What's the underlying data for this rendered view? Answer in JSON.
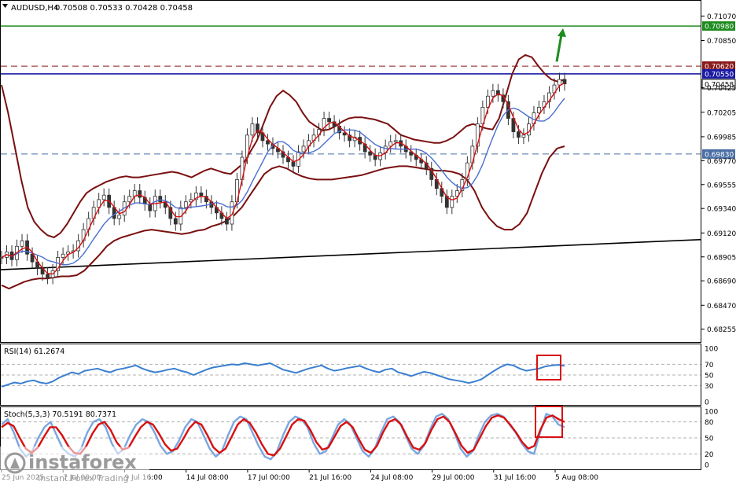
{
  "chart_data": {
    "type": "line",
    "symbol": "AUDUSD,H4",
    "ohlc": "0.70508 0.70533 0.70428 0.70458",
    "price_axis": {
      "ylim": [
        0.6814,
        0.712
      ],
      "ticks": [
        "0.71070",
        "0.70850",
        "0.70425",
        "0.70205",
        "0.69985",
        "0.69770",
        "0.69555",
        "0.69340",
        "0.69120",
        "0.68905",
        "0.68690",
        "0.68470",
        "0.68255"
      ],
      "tick_values": [
        0.7107,
        0.7085,
        0.70425,
        0.70205,
        0.69985,
        0.6977,
        0.69555,
        0.6934,
        0.6912,
        0.68905,
        0.6869,
        0.6847,
        0.68255
      ]
    },
    "levels": [
      {
        "value": 0.7098,
        "label": "0.70980",
        "color": "#1e8c1e",
        "style": "solid"
      },
      {
        "value": 0.7062,
        "label": "0.70620",
        "color": "#8b1a1a",
        "style": "dashed"
      },
      {
        "value": 0.7055,
        "label": "0.70550",
        "color": "#1a1aa6",
        "style": "solid"
      },
      {
        "value": 0.70458,
        "label": "0.70458",
        "color": "#111111",
        "style": "current"
      },
      {
        "value": 0.6983,
        "label": "0.69830",
        "color": "#4a6fa5",
        "style": "dashed"
      }
    ],
    "x_labels": [
      "25 Jun 2025",
      "7 Jul 00:00",
      "9 Jul 16:00",
      "14 Jul 08:00",
      "17 Jul 00:00",
      "21 Jul 16:00",
      "24 Jul 08:00",
      "29 Jul 00:00",
      "31 Jul 16:00",
      "5 Aug 08:00"
    ],
    "trendline": {
      "from": [
        0,
        0.6879
      ],
      "to": [
        134,
        0.6906
      ]
    },
    "series": [
      {
        "name": "price",
        "color": "#3a3a3a",
        "values": [
          0.689,
          0.6895,
          0.6888,
          0.69,
          0.6905,
          0.6893,
          0.6886,
          0.688,
          0.6875,
          0.6872,
          0.6878,
          0.689,
          0.6893,
          0.6895,
          0.6896,
          0.6905,
          0.6915,
          0.6925,
          0.6935,
          0.6942,
          0.6946,
          0.6935,
          0.6925,
          0.6928,
          0.694,
          0.6945,
          0.695,
          0.6944,
          0.6938,
          0.6932,
          0.6945,
          0.694,
          0.6935,
          0.6925,
          0.692,
          0.6935,
          0.694,
          0.6942,
          0.6948,
          0.6945,
          0.694,
          0.6935,
          0.693,
          0.6925,
          0.692,
          0.694,
          0.696,
          0.698,
          0.7,
          0.701,
          0.7002,
          0.6995,
          0.6992,
          0.6988,
          0.6985,
          0.698,
          0.6976,
          0.6972,
          0.6985,
          0.699,
          0.6995,
          0.7,
          0.7005,
          0.7015,
          0.7012,
          0.7008,
          0.7002,
          0.7,
          0.6995,
          0.6998,
          0.6992,
          0.6985,
          0.6982,
          0.6978,
          0.6984,
          0.699,
          0.6994,
          0.6995,
          0.699,
          0.6985,
          0.6982,
          0.6978,
          0.6975,
          0.697,
          0.696,
          0.6952,
          0.6945,
          0.6935,
          0.6945,
          0.695,
          0.696,
          0.6975,
          0.699,
          0.701,
          0.7025,
          0.7035,
          0.704,
          0.7036,
          0.703,
          0.7015,
          0.7003,
          0.6998,
          0.7,
          0.701,
          0.702,
          0.7025,
          0.703,
          0.7038,
          0.7045,
          0.705,
          0.7046
        ]
      },
      {
        "name": "bb_upper",
        "color": "#7a1010",
        "values": [
          0.7045,
          0.702,
          0.699,
          0.696,
          0.6935,
          0.6922,
          0.6915,
          0.691,
          0.6908,
          0.6912,
          0.692,
          0.693,
          0.694,
          0.6948,
          0.6952,
          0.6955,
          0.6958,
          0.696,
          0.6962,
          0.6963,
          0.6962,
          0.6962,
          0.6963,
          0.6964,
          0.6965,
          0.6966,
          0.6967,
          0.6966,
          0.6964,
          0.6962,
          0.6965,
          0.6968,
          0.697,
          0.6968,
          0.6966,
          0.6965,
          0.697,
          0.6975,
          0.6985,
          0.6995,
          0.701,
          0.7025,
          0.7035,
          0.704,
          0.7036,
          0.703,
          0.702,
          0.7012,
          0.7008,
          0.7004,
          0.7005,
          0.7008,
          0.7012,
          0.7015,
          0.7016,
          0.7016,
          0.7015,
          0.7014,
          0.7012,
          0.701,
          0.7005,
          0.7,
          0.6998,
          0.6996,
          0.6995,
          0.6994,
          0.6993,
          0.6993,
          0.6995,
          0.6998,
          0.7003,
          0.7008,
          0.701,
          0.7008,
          0.7006,
          0.7005,
          0.7015,
          0.7035,
          0.7055,
          0.7068,
          0.7072,
          0.707,
          0.7062,
          0.7055,
          0.705,
          0.7048,
          0.705
        ]
      },
      {
        "name": "bb_lower",
        "color": "#7a1010",
        "values": [
          0.6865,
          0.6862,
          0.6865,
          0.6868,
          0.687,
          0.6871,
          0.6871,
          0.6872,
          0.6873,
          0.6873,
          0.6874,
          0.6878,
          0.6885,
          0.6892,
          0.69,
          0.6905,
          0.6908,
          0.691,
          0.6912,
          0.6914,
          0.6915,
          0.6914,
          0.6913,
          0.6912,
          0.6911,
          0.6912,
          0.6914,
          0.6915,
          0.6918,
          0.692,
          0.6923,
          0.6928,
          0.6935,
          0.6945,
          0.6955,
          0.6965,
          0.697,
          0.6972,
          0.697,
          0.6966,
          0.6963,
          0.6961,
          0.696,
          0.696,
          0.696,
          0.6961,
          0.6962,
          0.6963,
          0.6964,
          0.6966,
          0.6968,
          0.697,
          0.6971,
          0.6972,
          0.6972,
          0.6971,
          0.697,
          0.6969,
          0.6968,
          0.6968,
          0.6967,
          0.6965,
          0.696,
          0.695,
          0.6935,
          0.6925,
          0.6918,
          0.6915,
          0.6915,
          0.692,
          0.693,
          0.6948,
          0.6966,
          0.698,
          0.6988,
          0.699
        ]
      }
    ],
    "rsi": {
      "label": "RSI(14) 61.2674",
      "ylim": [
        0,
        100
      ],
      "ticks": [
        "100",
        "70",
        "50",
        "30",
        "0"
      ],
      "tick_values": [
        100,
        70,
        50,
        30,
        0
      ],
      "color": "#3a7fd0",
      "values": [
        28,
        32,
        36,
        34,
        38,
        40,
        36,
        34,
        38,
        45,
        50,
        55,
        52,
        58,
        60,
        62,
        58,
        55,
        60,
        62,
        65,
        68,
        62,
        58,
        55,
        57,
        60,
        62,
        58,
        55,
        50,
        55,
        60,
        64,
        66,
        68,
        70,
        69,
        72,
        70,
        68,
        70,
        72,
        66,
        60,
        57,
        54,
        58,
        62,
        65,
        68,
        62,
        58,
        60,
        63,
        65,
        67,
        62,
        58,
        55,
        60,
        62,
        55,
        52,
        48,
        52,
        56,
        54,
        50,
        46,
        42,
        40,
        38,
        35,
        38,
        42,
        50,
        58,
        65,
        70,
        68,
        62,
        58,
        60,
        62,
        66,
        68,
        69,
        67
      ]
    },
    "stochastic": {
      "label": "Stoch(5,3,3) 70.5191 80.7371",
      "ylim": [
        0,
        100
      ],
      "ticks": [
        "100",
        "80",
        "50",
        "20",
        "0"
      ],
      "tick_values": [
        100,
        80,
        50,
        20,
        0
      ],
      "k_color": "#7aa6e0",
      "d_color": "#d81010",
      "k": [
        75,
        85,
        60,
        30,
        15,
        25,
        50,
        70,
        80,
        55,
        30,
        20,
        15,
        30,
        60,
        80,
        85,
        70,
        40,
        20,
        30,
        55,
        75,
        85,
        80,
        60,
        35,
        20,
        25,
        45,
        70,
        85,
        80,
        55,
        30,
        15,
        25,
        55,
        80,
        90,
        85,
        60,
        35,
        15,
        10,
        25,
        55,
        80,
        90,
        85,
        70,
        40,
        20,
        25,
        50,
        75,
        85,
        75,
        50,
        25,
        15,
        30,
        60,
        85,
        90,
        80,
        55,
        30,
        20,
        35,
        65,
        90,
        95,
        85,
        60,
        30,
        15,
        25,
        55,
        80,
        92,
        95,
        90,
        75,
        60,
        40,
        25,
        20,
        60,
        95,
        90,
        75,
        70
      ],
      "d": [
        70,
        78,
        72,
        50,
        30,
        22,
        32,
        52,
        70,
        70,
        55,
        35,
        22,
        20,
        35,
        58,
        75,
        80,
        65,
        42,
        28,
        32,
        52,
        70,
        80,
        75,
        58,
        38,
        26,
        30,
        48,
        68,
        80,
        75,
        55,
        32,
        22,
        30,
        52,
        75,
        85,
        78,
        60,
        38,
        20,
        17,
        30,
        52,
        75,
        85,
        82,
        65,
        42,
        28,
        32,
        52,
        72,
        80,
        70,
        48,
        28,
        22,
        35,
        60,
        80,
        85,
        75,
        52,
        32,
        28,
        40,
        65,
        85,
        90,
        80,
        58,
        35,
        22,
        28,
        50,
        72,
        88,
        92,
        88,
        75,
        60,
        42,
        30,
        35,
        65,
        88,
        92,
        85,
        80
      ]
    },
    "annotations": [
      {
        "kind": "arrow",
        "color": "#1e8c1e",
        "direction": "up"
      },
      {
        "kind": "highlight-box",
        "panel": "rsi",
        "color": "#d81010"
      },
      {
        "kind": "highlight-box",
        "panel": "stochastic",
        "color": "#d81010"
      }
    ]
  },
  "watermark": {
    "brand": "instaforex",
    "tagline": "Instant Forex Trading"
  }
}
